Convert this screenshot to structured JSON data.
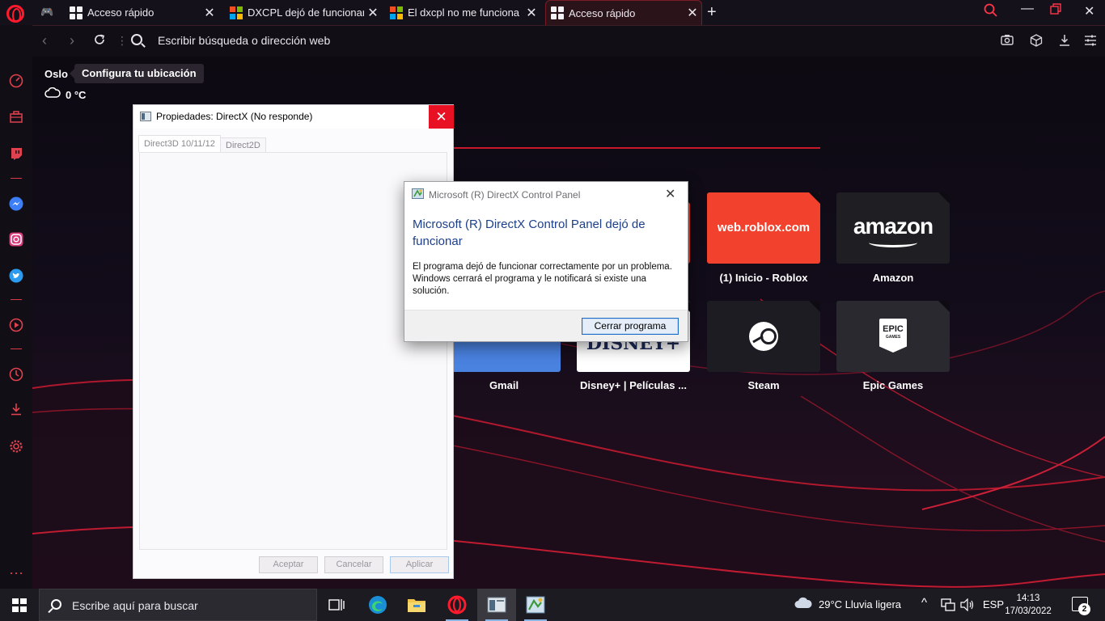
{
  "browser": {
    "tabs": [
      {
        "title": "Acceso rápido",
        "icon": "speed-dial-icon",
        "active": false
      },
      {
        "title": "DXCPL dejó de funcionar ≡",
        "icon": "microsoft-icon",
        "active": false
      },
      {
        "title": "El dxcpl no me funciona cu",
        "icon": "microsoft-icon",
        "active": false
      },
      {
        "title": "Acceso rápido",
        "icon": "speed-dial-icon",
        "active": true
      }
    ],
    "address_placeholder": "Escribir búsqueda o dirección web",
    "accent": "#ff1b2d"
  },
  "sidebar": {
    "items": [
      "speedometer-icon",
      "briefcase-icon",
      "twitch-icon",
      "messenger-icon",
      "instagram-icon",
      "twitter-icon",
      "player-icon",
      "history-icon",
      "downloads-icon",
      "settings-icon",
      "more-icon"
    ]
  },
  "weather": {
    "city": "Oslo",
    "location_tip": "Configura tu ubicación",
    "temperature": "0 °C"
  },
  "speed_dials": [
    {
      "label": "(1) Inicio - Roblox",
      "logo": "web.roblox.com",
      "color": "#f2412d"
    },
    {
      "label": "Amazon",
      "logo": "amazon",
      "color": "#1f1e23"
    },
    {
      "label": "Gmail",
      "logo": "",
      "color": "#4a82e0"
    },
    {
      "label": "Disney+ | Películas ...",
      "logo": "DISNEY+",
      "color": "#ffffff"
    },
    {
      "label": "Steam",
      "logo": "",
      "color": "#1d1c22"
    },
    {
      "label": "Epic Games",
      "logo": "EPIC",
      "logo_sub": "GAMES",
      "color": "#2a2930"
    }
  ],
  "dx_window": {
    "title": "Propiedades: DirectX (No responde)",
    "tabs": [
      "Direct3D 10/11/12",
      "Direct2D"
    ],
    "buttons": {
      "accept": "Aceptar",
      "cancel": "Cancelar",
      "apply": "Aplicar"
    }
  },
  "error_dialog": {
    "title": "Microsoft (R) DirectX Control Panel",
    "heading": "Microsoft (R) DirectX Control Panel dejó de funcionar",
    "body": "El programa dejó de funcionar correctamente por un problema. Windows cerrará el programa y le notificará si existe una solución.",
    "button": "Cerrar programa"
  },
  "taskbar": {
    "search_placeholder": "Escribe aquí para buscar",
    "weather": "29°C  Lluvia ligera",
    "language": "ESP",
    "time": "14:13",
    "date": "17/03/2022",
    "notifications": "2"
  }
}
